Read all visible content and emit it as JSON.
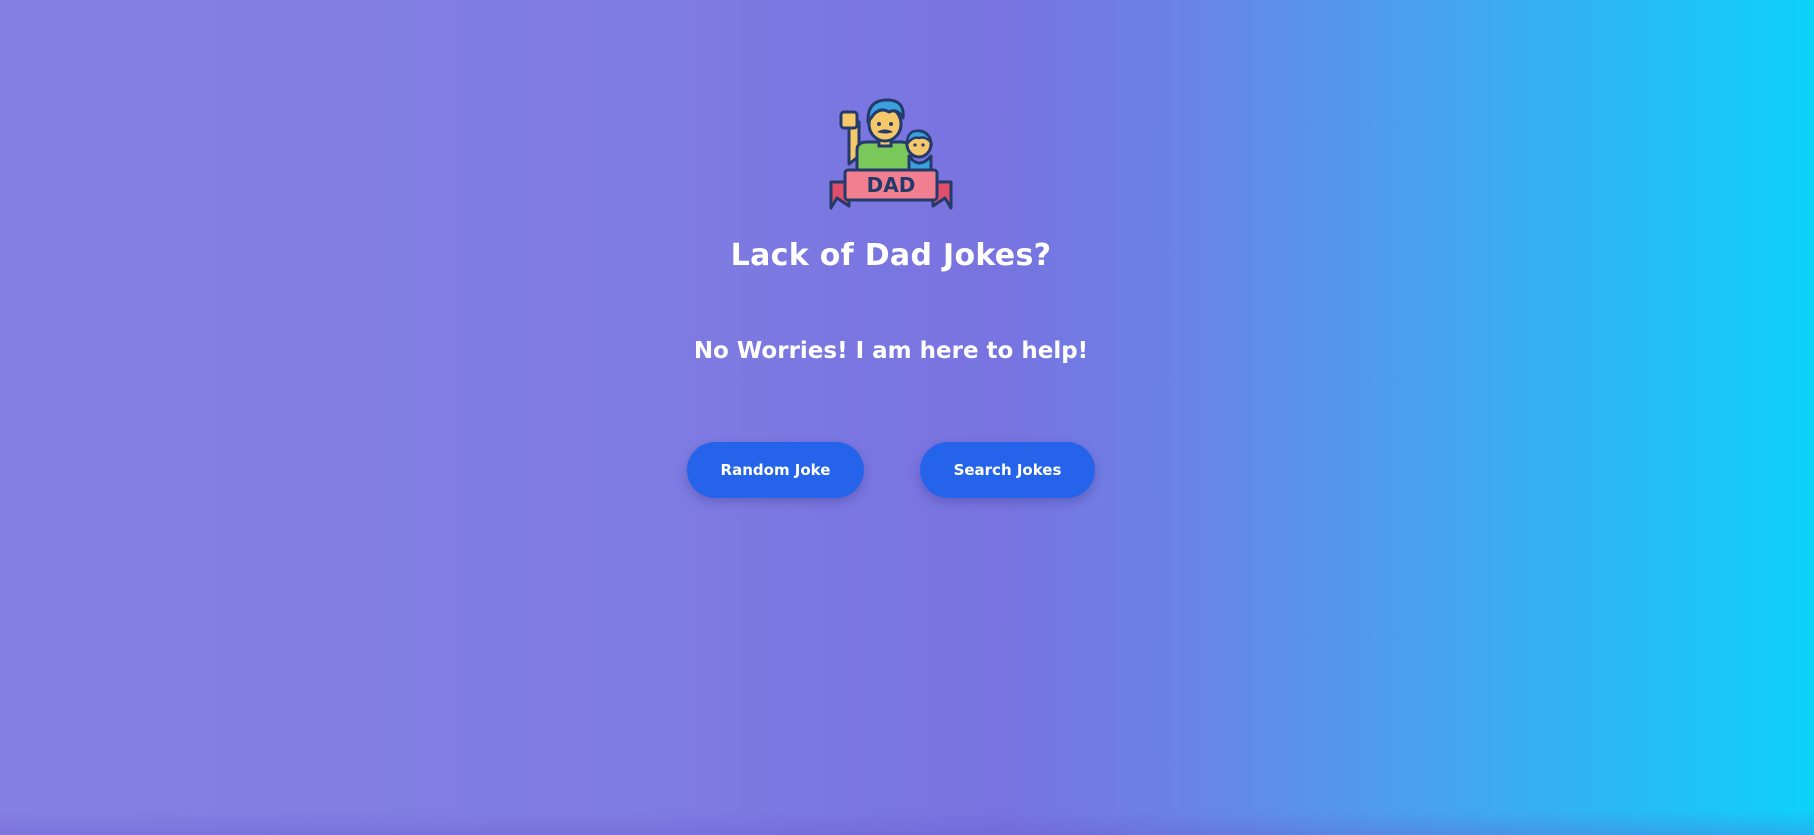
{
  "page": {
    "title": "Lack of Dad Jokes?",
    "subtitle": "No Worries! I am here to help!"
  },
  "logo": {
    "icon": "dad-with-baby-icon",
    "banner_text": "DAD"
  },
  "buttons": {
    "random_label": "Random Joke",
    "search_label": "Search Jokes"
  },
  "colors": {
    "button_bg": "#2563eb",
    "gradient_start": "#8580e3",
    "gradient_end": "#0dd1fd",
    "text": "#ffffff"
  }
}
